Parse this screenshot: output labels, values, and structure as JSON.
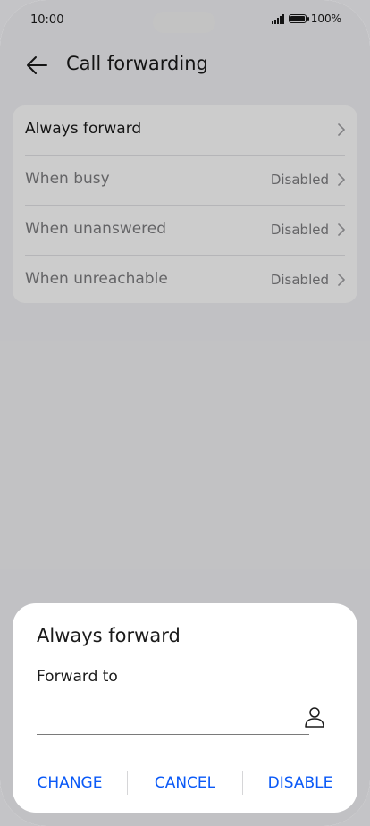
{
  "status_bar": {
    "time": "10:00",
    "battery": "100%"
  },
  "header": {
    "title": "Call forwarding"
  },
  "list": {
    "items": [
      {
        "label": "Always forward",
        "value": ""
      },
      {
        "label": "When busy",
        "value": "Disabled"
      },
      {
        "label": "When unanswered",
        "value": "Disabled"
      },
      {
        "label": "When unreachable",
        "value": "Disabled"
      }
    ]
  },
  "dialog": {
    "title": "Always forward",
    "field_label": "Forward to",
    "input_value": "",
    "buttons": {
      "change": "CHANGE",
      "cancel": "CANCEL",
      "disable": "DISABLE"
    }
  },
  "colors": {
    "accent": "#0a59f7",
    "scrim": "rgba(0,0,0,0.2)"
  }
}
